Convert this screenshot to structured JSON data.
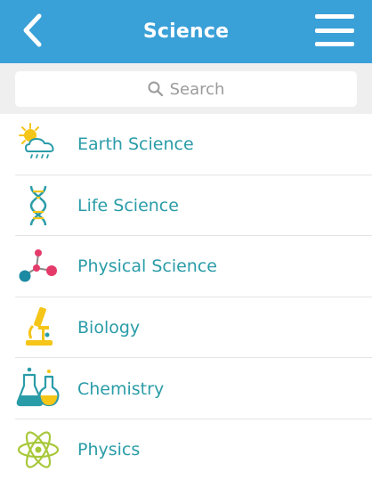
{
  "header": {
    "title": "Science",
    "back_icon": "chevron-left-icon",
    "menu_icon": "hamburger-menu-icon"
  },
  "search": {
    "placeholder": "Search",
    "icon": "search-icon"
  },
  "list": {
    "items": [
      {
        "label": "Earth Science",
        "icon": "weather-cloud-sun-icon"
      },
      {
        "label": "Life Science",
        "icon": "dna-icon"
      },
      {
        "label": "Physical Science",
        "icon": "molecule-icon"
      },
      {
        "label": "Biology",
        "icon": "microscope-icon"
      },
      {
        "label": "Chemistry",
        "icon": "flask-icon"
      },
      {
        "label": "Physics",
        "icon": "atom-icon"
      }
    ]
  },
  "colors": {
    "header_bg": "#3aa0d8",
    "label_text": "#2a9ca8",
    "search_band": "#efefef"
  }
}
